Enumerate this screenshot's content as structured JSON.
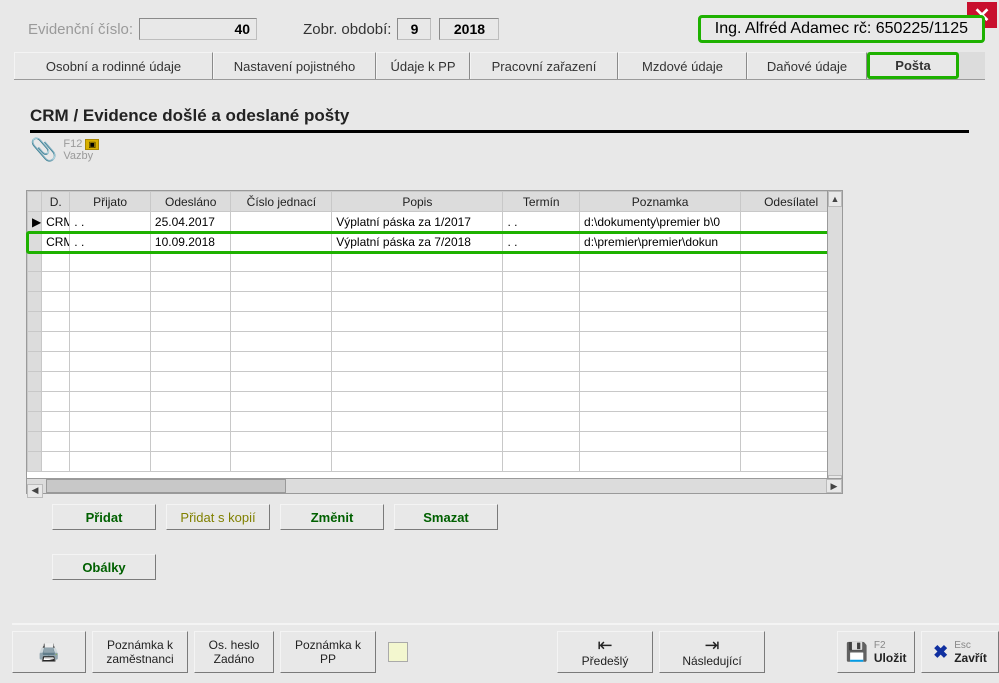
{
  "header": {
    "ev_label": "Evidenční číslo:",
    "ev_value": "40",
    "zobr_label": "Zobr. období:",
    "zobr_month": "9",
    "zobr_year": "2018",
    "user_name": "Ing. Alfréd Adamec rč: 650225/1125"
  },
  "tabs": [
    "Osobní a rodinné údaje",
    "Nastavení pojistného",
    "Údaje k PP",
    "Pracovní zařazení",
    "Mzdové údaje",
    "Daňové údaje",
    "Pošta"
  ],
  "section": {
    "title": "CRM / Evidence došlé a odeslané pošty",
    "f12_label": "F12",
    "vazby_label": "Vazby"
  },
  "grid": {
    "headers": {
      "d": "D.",
      "prijato": "Přijato",
      "odeslano": "Odesláno",
      "cislo": "Číslo jednací",
      "popis": "Popis",
      "termin": "Termín",
      "poznamka": "Poznamka",
      "odesilatel": "Odesílatel"
    },
    "rows": [
      {
        "d": "CRM",
        "prijato": ". .",
        "odeslano": "25.04.2017",
        "cislo": "",
        "popis": "Výplatní páska za 1/2017",
        "termin": ". .",
        "poznamka": "d:\\dokumenty\\premier b\\0",
        "odesilatel": ""
      },
      {
        "d": "CRM",
        "prijato": ". .",
        "odeslano": "10.09.2018",
        "cislo": "",
        "popis": "Výplatní páska za 7/2018",
        "termin": ". .",
        "poznamka": "d:\\premier\\premier\\dokun",
        "odesilatel": ""
      }
    ]
  },
  "grid_buttons": {
    "pridat": "Přidat",
    "pridat_kopii": "Přidat s kopií",
    "zmenit": "Změnit",
    "smazat": "Smazat",
    "obalky": "Obálky"
  },
  "bottom": {
    "poznamka_zam_l1": "Poznámka k",
    "poznamka_zam_l2": "zaměstnanci",
    "osheslo_l1": "Os. heslo",
    "osheslo_l2": "Zadáno",
    "poznamka_pp_l1": "Poznámka k",
    "poznamka_pp_l2": "PP",
    "predesly": "Předešlý",
    "nasledujici": "Následující",
    "ulozit": "Uložit",
    "ulozit_key": "F2",
    "zavrit": "Zavřít",
    "zavrit_key": "Esc"
  }
}
